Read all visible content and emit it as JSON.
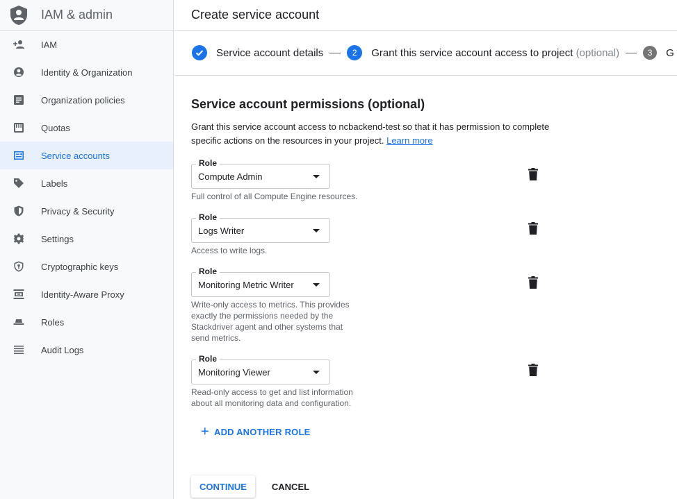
{
  "app": {
    "title": "IAM & admin"
  },
  "sidebar": {
    "items": [
      {
        "label": "IAM",
        "icon": "person-add-icon",
        "active": false
      },
      {
        "label": "Identity & Organization",
        "icon": "account-circle-icon",
        "active": false
      },
      {
        "label": "Organization policies",
        "icon": "document-list-icon",
        "active": false
      },
      {
        "label": "Quotas",
        "icon": "quota-icon",
        "active": false
      },
      {
        "label": "Service accounts",
        "icon": "service-account-icon",
        "active": true
      },
      {
        "label": "Labels",
        "icon": "label-tag-icon",
        "active": false
      },
      {
        "label": "Privacy & Security",
        "icon": "shield-icon",
        "active": false
      },
      {
        "label": "Settings",
        "icon": "gear-icon",
        "active": false
      },
      {
        "label": "Cryptographic keys",
        "icon": "key-shield-icon",
        "active": false
      },
      {
        "label": "Identity-Aware Proxy",
        "icon": "proxy-icon",
        "active": false
      },
      {
        "label": "Roles",
        "icon": "roles-hat-icon",
        "active": false
      },
      {
        "label": "Audit Logs",
        "icon": "list-lines-icon",
        "active": false
      }
    ]
  },
  "header": {
    "title": "Create service account"
  },
  "stepper": {
    "steps": [
      {
        "number": "1",
        "label": "Service account details",
        "optional": "",
        "state": "done"
      },
      {
        "number": "2",
        "label": "Grant this service account access to project",
        "optional": "(optional)",
        "state": "current"
      },
      {
        "number": "3",
        "label": "G",
        "optional": "",
        "state": "pending"
      }
    ]
  },
  "permissions": {
    "title": "Service account permissions (optional)",
    "description": "Grant this service account access to ncbackend-test so that it has permission to complete specific actions on the resources in your project.",
    "learn_more": "Learn more",
    "field_label": "Role",
    "roles": [
      {
        "value": "Compute Admin",
        "help": "Full control of all Compute Engine resources."
      },
      {
        "value": "Logs Writer",
        "help": "Access to write logs."
      },
      {
        "value": "Monitoring Metric Writer",
        "help": "Write-only access to metrics. This provides exactly the permissions needed by the Stackdriver agent and other systems that send metrics."
      },
      {
        "value": "Monitoring Viewer",
        "help": "Read-only access to get and list information about all monitoring data and configuration."
      }
    ],
    "add_role": "ADD ANOTHER ROLE"
  },
  "actions": {
    "continue": "CONTINUE",
    "cancel": "CANCEL"
  },
  "colors": {
    "accent": "#1a73e8",
    "active_bg": "#e8f0fe",
    "sidebar_bg": "#f8f9fa"
  }
}
